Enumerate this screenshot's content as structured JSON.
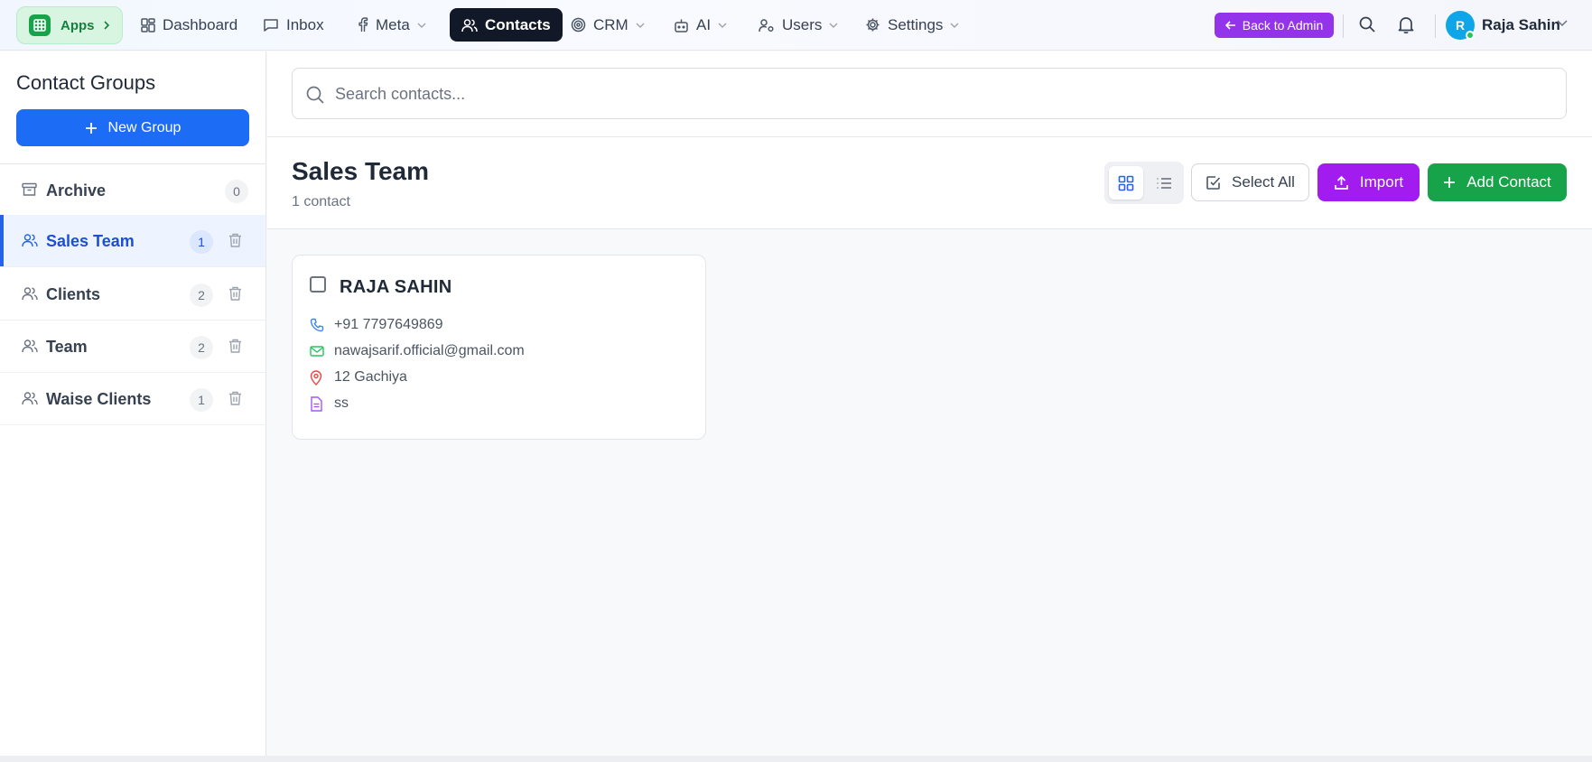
{
  "nav": {
    "apps_label": "Apps",
    "items": [
      {
        "label": "Dashboard",
        "icon": "dashboard-icon"
      },
      {
        "label": "Inbox",
        "icon": "inbox-icon"
      },
      {
        "label": "Meta",
        "icon": "facebook-icon"
      },
      {
        "label": "Contacts",
        "icon": "users-icon"
      },
      {
        "label": "CRM",
        "icon": "target-icon"
      },
      {
        "label": "AI",
        "icon": "bot-icon"
      },
      {
        "label": "Users",
        "icon": "user-cog-icon"
      },
      {
        "label": "Settings",
        "icon": "gear-icon"
      }
    ],
    "back_to_admin": "Back to Admin",
    "user_initial": "R",
    "user_name": "Raja Sahin"
  },
  "sidebar": {
    "title": "Contact Groups",
    "new_group_label": "New Group",
    "groups": [
      {
        "label": "Archive",
        "count": "0"
      },
      {
        "label": "Sales Team",
        "count": "1"
      },
      {
        "label": "Clients",
        "count": "2"
      },
      {
        "label": "Team",
        "count": "2"
      },
      {
        "label": "Waise Clients",
        "count": "1"
      }
    ]
  },
  "search": {
    "placeholder": "Search contacts..."
  },
  "main": {
    "title": "Sales Team",
    "subtitle": "1 contact",
    "select_all_label": "Select All",
    "import_label": "Import",
    "add_contact_label": "Add Contact"
  },
  "contacts": [
    {
      "name": "RAJA SAHIN",
      "phone": "+91 7797649869",
      "email": "nawajsarif.official@gmail.com",
      "address": "12 Gachiya",
      "notes": "ss"
    }
  ],
  "colors": {
    "primary": "#1d6cf5",
    "active_nav": "#111827",
    "back_admin": "#9333ea",
    "import": "#a21cf0",
    "add_contact": "#16a34a",
    "apps": "#16a34a"
  }
}
